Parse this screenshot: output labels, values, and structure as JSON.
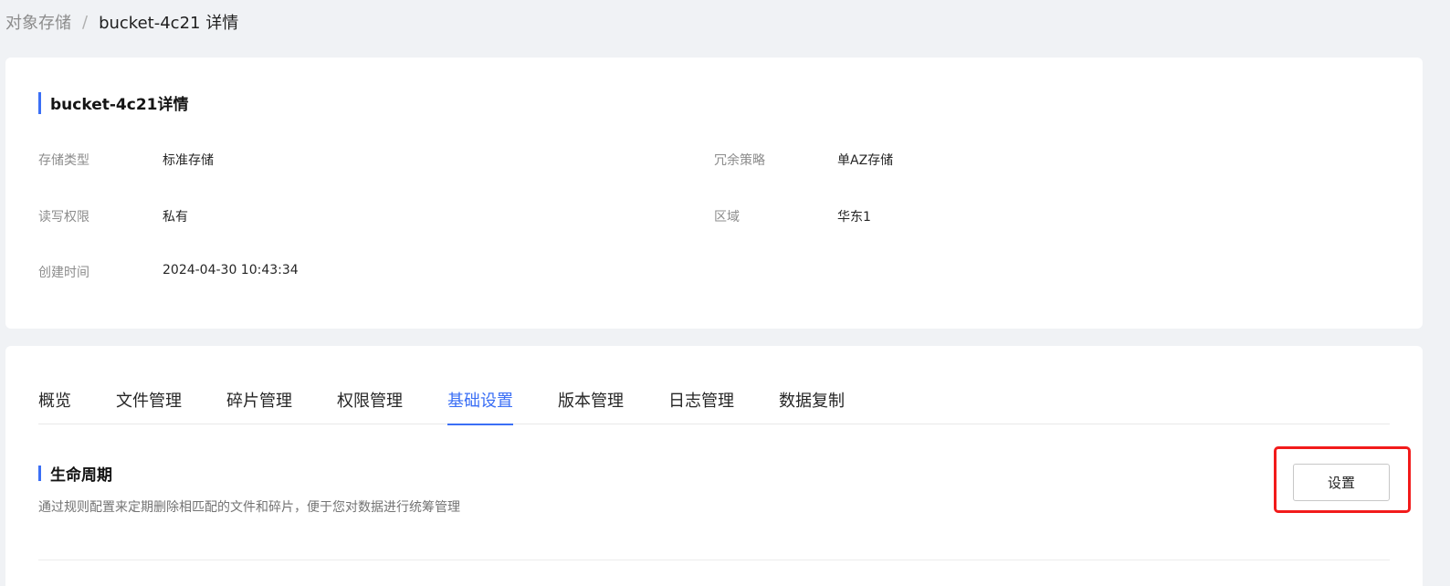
{
  "breadcrumb": {
    "root": "对象存储",
    "separator": "/",
    "current": "bucket-4c21 详情"
  },
  "info": {
    "title": "bucket-4c21详情",
    "fields": [
      {
        "label": "存储类型",
        "value": "标准存储"
      },
      {
        "label": "冗余策略",
        "value": "单AZ存储"
      },
      {
        "label": "读写权限",
        "value": "私有"
      },
      {
        "label": "区域",
        "value": "华东1"
      },
      {
        "label": "创建时间",
        "value": "2024-04-30 10:43:34"
      }
    ]
  },
  "tabs": [
    {
      "label": "概览"
    },
    {
      "label": "文件管理"
    },
    {
      "label": "碎片管理"
    },
    {
      "label": "权限管理"
    },
    {
      "label": "基础设置",
      "active": true
    },
    {
      "label": "版本管理"
    },
    {
      "label": "日志管理"
    },
    {
      "label": "数据复制"
    }
  ],
  "lifecycle": {
    "title": "生命周期",
    "description": "通过规则配置来定期删除相匹配的文件和碎片，便于您对数据进行统筹管理",
    "button_label": "设置"
  },
  "colors": {
    "accent": "#3b6ff5",
    "highlight": "#f21b1b",
    "background": "#f0f2f5"
  }
}
